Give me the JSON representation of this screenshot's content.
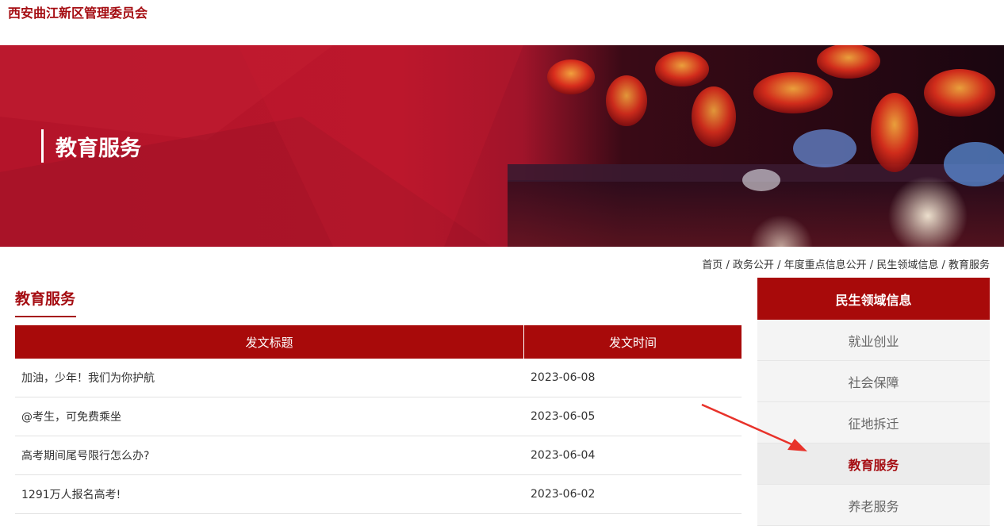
{
  "header": {
    "site_title": "西安曲江新区管理委员会"
  },
  "banner": {
    "title": "教育服务"
  },
  "breadcrumb": {
    "items": [
      "首页",
      "政务公开",
      "年度重点信息公开",
      "民生领域信息",
      "教育服务"
    ],
    "separator": " / "
  },
  "section": {
    "title": "教育服务"
  },
  "table": {
    "columns": [
      "发文标题",
      "发文时间"
    ],
    "rows": [
      {
        "title": "加油，少年！我们为你护航",
        "date": "2023-06-08"
      },
      {
        "title": "@考生，可免费乘坐",
        "date": "2023-06-05"
      },
      {
        "title": "高考期间尾号限行怎么办?",
        "date": "2023-06-04"
      },
      {
        "title": "1291万人报名高考!",
        "date": "2023-06-02"
      }
    ]
  },
  "sidebar": {
    "heading": "民生领域信息",
    "items": [
      {
        "label": "就业创业",
        "active": false
      },
      {
        "label": "社会保障",
        "active": false
      },
      {
        "label": "征地拆迁",
        "active": false
      },
      {
        "label": "教育服务",
        "active": true
      },
      {
        "label": "养老服务",
        "active": false
      }
    ]
  },
  "colors": {
    "brand_red": "#a80a0a",
    "title_red": "#a50d12",
    "arrow_red": "#e8322a"
  }
}
